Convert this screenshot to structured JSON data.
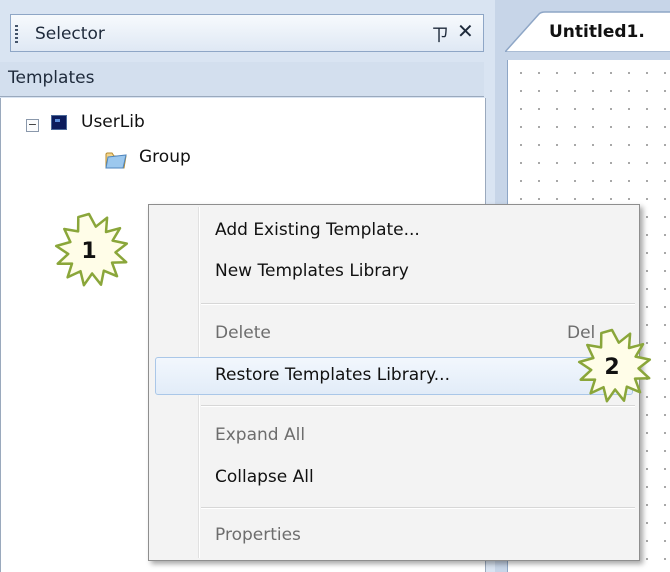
{
  "panel": {
    "title": "Selector",
    "pin_glyph": "ㄗ",
    "close_glyph": "✕",
    "section_label": "Templates",
    "tree": {
      "expander_glyph": "−",
      "root_label": "UserLib",
      "child_label": "Group"
    }
  },
  "document": {
    "tab_label": "Untitled1."
  },
  "menu": {
    "items": [
      {
        "label": "Add Existing Template...",
        "enabled": true
      },
      {
        "label": "New Templates Library",
        "enabled": true
      },
      {
        "label": "Delete",
        "enabled": false,
        "shortcut": "Del"
      },
      {
        "label": "Restore Templates Library...",
        "enabled": true,
        "highlighted": true
      },
      {
        "label": "Expand All",
        "enabled": false
      },
      {
        "label": "Collapse All",
        "enabled": true
      },
      {
        "label": "Properties",
        "enabled": false
      }
    ]
  },
  "callouts": [
    {
      "number": "1"
    },
    {
      "number": "2"
    }
  ],
  "colors": {
    "burst_fill": "#fffde8",
    "burst_stroke": "#8aa63a",
    "highlight": "#e2ecf8"
  }
}
